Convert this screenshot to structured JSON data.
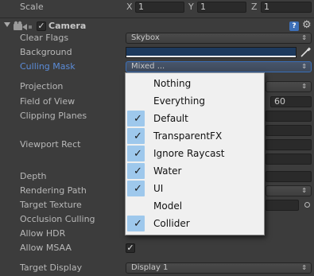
{
  "transform": {
    "scale_label": "Scale",
    "x_axis": "X",
    "x_value": "1",
    "y_axis": "Y",
    "y_value": "1",
    "z_axis": "Z",
    "z_value": "1"
  },
  "component": {
    "title": "Camera",
    "enabled_mark": "✓",
    "help_glyph": "?",
    "gear_glyph": "⚙"
  },
  "properties": {
    "clear_flags_label": "Clear Flags",
    "clear_flags_value": "Skybox",
    "background_label": "Background",
    "background_color": "#1d3a5e",
    "culling_mask_label": "Culling Mask",
    "culling_mask_value": "Mixed ...",
    "projection_label": "Projection",
    "fov_label": "Field of View",
    "fov_value": "60",
    "clipping_label": "Clipping Planes",
    "viewport_label": "Viewport Rect",
    "depth_label": "Depth",
    "rendering_path_label": "Rendering Path",
    "target_texture_label": "Target Texture",
    "occlusion_label": "Occlusion Culling",
    "allow_hdr_label": "Allow HDR",
    "allow_msaa_label": "Allow MSAA",
    "allow_msaa_mark": "✓",
    "target_display_label": "Target Display",
    "target_display_value": "Display 1"
  },
  "dropdown_arrows": "⇕",
  "culling_menu": {
    "items": [
      {
        "label": "Nothing",
        "checked": false
      },
      {
        "label": "Everything",
        "checked": false
      },
      {
        "label": "Default",
        "checked": true
      },
      {
        "label": "TransparentFX",
        "checked": true
      },
      {
        "label": "Ignore Raycast",
        "checked": true
      },
      {
        "label": "Water",
        "checked": true
      },
      {
        "label": "UI",
        "checked": true
      },
      {
        "label": "Model",
        "checked": false
      },
      {
        "label": "Collider",
        "checked": true
      }
    ],
    "check_glyph": "✓"
  },
  "colors": {
    "panel_bg": "#3c3c3c",
    "highlight_label": "#5b8cd8",
    "menu_check_bg": "#9ec8ec",
    "menu_bg": "#f0f0f0"
  }
}
